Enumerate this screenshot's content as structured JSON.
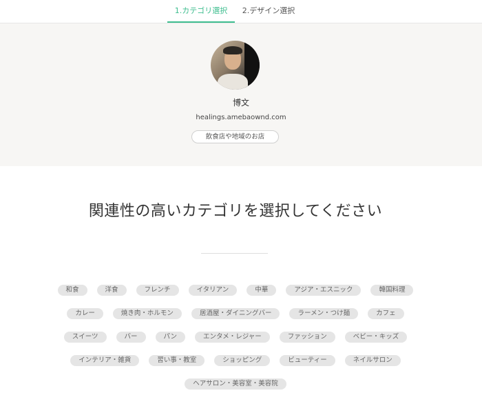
{
  "tabs": [
    {
      "label": "1.カテゴリ選択",
      "active": true
    },
    {
      "label": "2.デザイン選択",
      "active": false
    }
  ],
  "profile": {
    "name": "博文",
    "url": "healings.amebaownd.com",
    "category": "飲食店や地域のお店"
  },
  "heading": "関連性の高いカテゴリを選択してください",
  "tags": {
    "row1": [
      "和食",
      "洋食",
      "フレンチ",
      "イタリアン",
      "中華",
      "アジア・エスニック",
      "韓国料理"
    ],
    "row2": [
      "カレー",
      "焼き肉・ホルモン",
      "居酒屋・ダイニングバー",
      "ラーメン・つけ麺",
      "カフェ"
    ],
    "row3": [
      "スイーツ",
      "バー",
      "パン",
      "エンタメ・レジャー",
      "ファッション",
      "ベビー・キッズ"
    ],
    "row4": [
      "インテリア・雑貨",
      "習い事・教室",
      "ショッピング",
      "ビューティー",
      "ネイルサロン"
    ],
    "row5": [
      "ヘアサロン・美容室・美容院"
    ]
  },
  "colors": {
    "accent": "#3dbd8e",
    "profile_bg": "#f7f6f4",
    "tag_bg": "#e5e5e5"
  }
}
